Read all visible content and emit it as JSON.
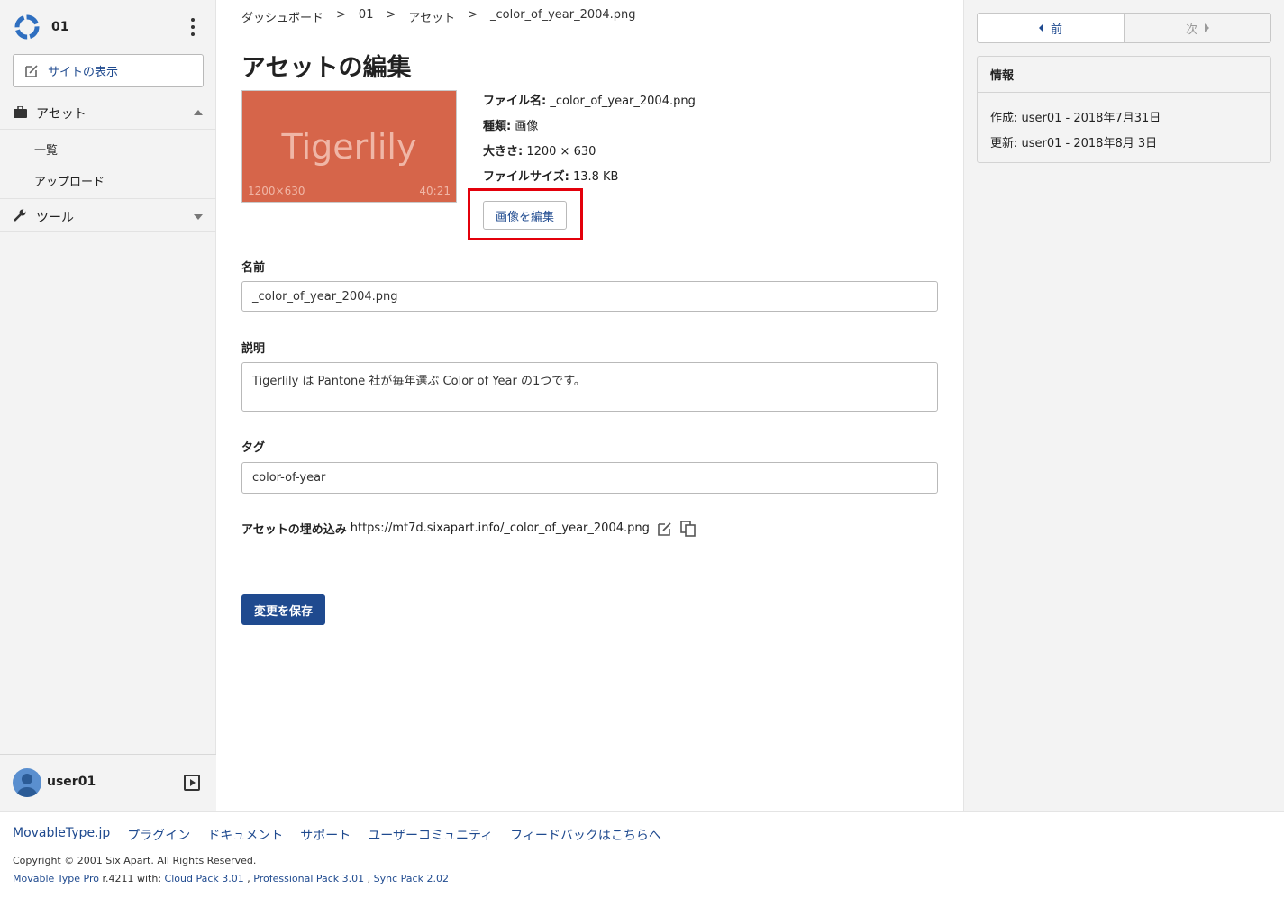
{
  "sidebar": {
    "site_name": "01",
    "view_site_label": "サイトの表示",
    "assets_label": "アセット",
    "assets_sub": [
      "一覧",
      "アップロード"
    ],
    "tools_label": "ツール",
    "user_name": "user01"
  },
  "breadcrumb": [
    "ダッシュボード",
    ">",
    "01",
    ">",
    "アセット",
    ">",
    "_color_of_year_2004.png"
  ],
  "page_title": "アセットの編集",
  "thumbnail": {
    "word": "Tigerlily",
    "dimensions": "1200×630",
    "ratio": "40:21",
    "color": "#d6654a"
  },
  "meta": {
    "filename_label": "ファイル名:",
    "filename_value": "_color_of_year_2004.png",
    "type_label": "種類:",
    "type_value": "画像",
    "size_label": "大きさ:",
    "size_value": "1200 × 630",
    "filesize_label": "ファイルサイズ:",
    "filesize_value": "13.8 KB"
  },
  "edit_image_label": "画像を編集",
  "fields": {
    "name_label": "名前",
    "name_value": "_color_of_year_2004.png",
    "description_label": "説明",
    "description_value": "Tigerlily は Pantone 社が毎年選ぶ Color of Year の1つです。",
    "tags_label": "タグ",
    "tags_value": "color-of-year"
  },
  "embed": {
    "label": "アセットの埋め込み",
    "url": "https://mt7d.sixapart.info/_color_of_year_2004.png"
  },
  "save_label": "変更を保存",
  "pager": {
    "prev": "前",
    "next": "次"
  },
  "info": {
    "title": "情報",
    "created": "作成: user01 - 2018年7月31日",
    "updated": "更新: user01 - 2018年8月 3日"
  },
  "footer": {
    "links": [
      "MovableType.jp",
      "プラグイン",
      "ドキュメント",
      "サポート",
      "ユーザーコミュニティ",
      "フィードバックはこちらへ"
    ],
    "copyright": "Copyright © 2001 Six Apart. All Rights Reserved.",
    "version_product": "Movable Type Pro",
    "version_rest": " r.4211 with: ",
    "packs": [
      "Cloud Pack 3.01",
      "Professional Pack 3.01",
      "Sync Pack 2.02"
    ],
    "separator": " , "
  },
  "colors": {
    "accent": "#1f4a8f",
    "highlight": "#e3000b"
  }
}
